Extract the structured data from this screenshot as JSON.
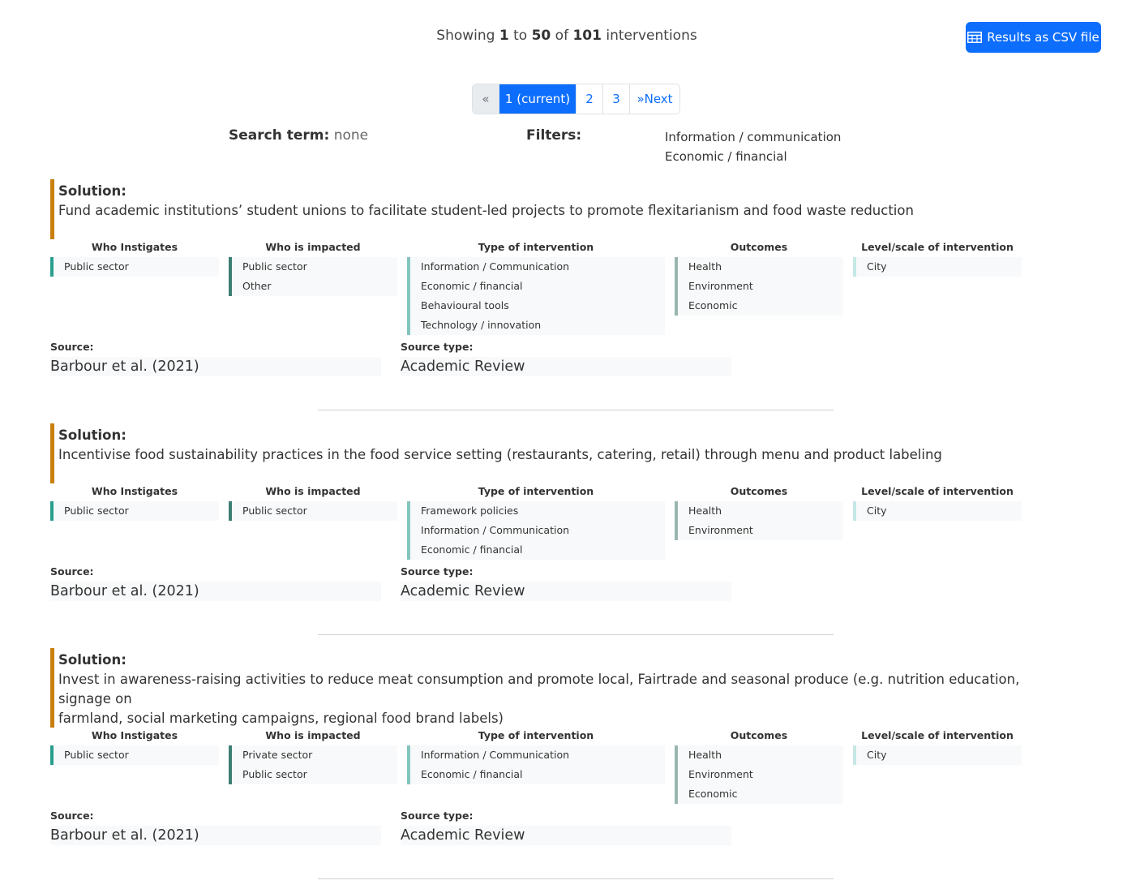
{
  "summary": {
    "prefix": "Showing",
    "from": "1",
    "to_word": "to",
    "to": "50",
    "of_word": "of",
    "total": "101",
    "suffix": "interventions"
  },
  "csv_button": {
    "label": "Results as CSV file",
    "icon": "table-icon"
  },
  "pagination": {
    "prev": "«",
    "current": "1 (current)",
    "page2": "2",
    "page3": "3",
    "next": "»Next"
  },
  "search": {
    "label": "Search term:",
    "value": "none"
  },
  "filters": {
    "label": "Filters:",
    "items": [
      "Information / communication",
      "Economic / financial"
    ]
  },
  "category_titles": {
    "instigates": "Who Instigates",
    "impacted": "Who is impacted",
    "type": "Type of intervention",
    "outcomes": "Outcomes",
    "level": "Level/scale of intervention"
  },
  "labels": {
    "solution": "Solution:",
    "source": "Source:",
    "source_type": "Source type:"
  },
  "colors": {
    "accent": "#0d6efd",
    "solution_bar": "#c97f0e",
    "instigates_bar": "#2a9d8f",
    "impacted_bar": "#3d8073",
    "type_bar": "#83c5be",
    "outcomes_bar": "#99b6b0",
    "level_bar": "#c6e8e5"
  },
  "solutions": [
    {
      "text": "Fund academic institutions’ student unions to facilitate student-led projects to promote flexitarianism and food waste reduction",
      "instigates": [
        "Public sector"
      ],
      "impacted": [
        "Public sector",
        "Other"
      ],
      "type": [
        "Information / Communication",
        "Economic / financial",
        "Behavioural tools",
        "Technology / innovation"
      ],
      "outcomes": [
        "Health",
        "Environment",
        "Economic"
      ],
      "level": [
        "City"
      ],
      "source": "Barbour et al. (2021)",
      "source_type": "Academic Review"
    },
    {
      "text": "Incentivise food sustainability practices in the food service setting (restaurants, catering, retail) through menu and product labeling",
      "instigates": [
        "Public sector"
      ],
      "impacted": [
        "Public sector"
      ],
      "type": [
        "Framework policies",
        "Information / Communication",
        "Economic / financial"
      ],
      "outcomes": [
        "Health",
        "Environment"
      ],
      "level": [
        "City"
      ],
      "source": "Barbour et al. (2021)",
      "source_type": "Academic Review"
    },
    {
      "text_line1": "Invest in awareness-raising activities to reduce meat consumption and promote local, Fairtrade and seasonal produce (e.g. nutrition education, signage on",
      "text_line2": "farmland, social marketing campaigns, regional food brand labels)",
      "instigates": [
        "Public sector"
      ],
      "impacted": [
        "Private sector",
        "Public sector"
      ],
      "type": [
        "Information / Communication",
        "Economic / financial"
      ],
      "outcomes": [
        "Health",
        "Environment",
        "Economic"
      ],
      "level": [
        "City"
      ],
      "source": "Barbour et al. (2021)",
      "source_type": "Academic Review"
    }
  ]
}
